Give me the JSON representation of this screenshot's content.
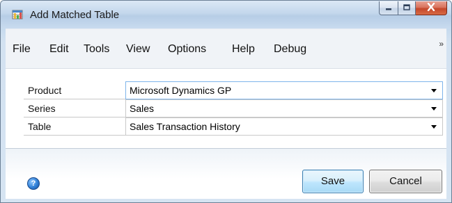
{
  "window": {
    "title": "Add Matched Table",
    "icon": "table-window-icon"
  },
  "caption_buttons": {
    "minimize_icon": "minimize-icon",
    "maximize_icon": "maximize-icon",
    "close_icon": "close-icon"
  },
  "menu": {
    "items": [
      {
        "label": "File"
      },
      {
        "label": "Edit"
      },
      {
        "label": "Tools"
      },
      {
        "label": "View"
      },
      {
        "label": "Options"
      },
      {
        "label": "Help"
      },
      {
        "label": "Debug"
      }
    ],
    "overflow": "»"
  },
  "fields": [
    {
      "label": "Product",
      "value": "Microsoft Dynamics GP"
    },
    {
      "label": "Series",
      "value": "Sales"
    },
    {
      "label": "Table",
      "value": "Sales Transaction History"
    }
  ],
  "footer": {
    "help_icon": "help-icon",
    "help_glyph": "?",
    "save_label": "Save",
    "cancel_label": "Cancel"
  },
  "colors": {
    "window_frame": "#b9d0e8",
    "close_button": "#c4472b",
    "default_button": "#bee6fd",
    "active_field_border": "#7eb4ea"
  }
}
